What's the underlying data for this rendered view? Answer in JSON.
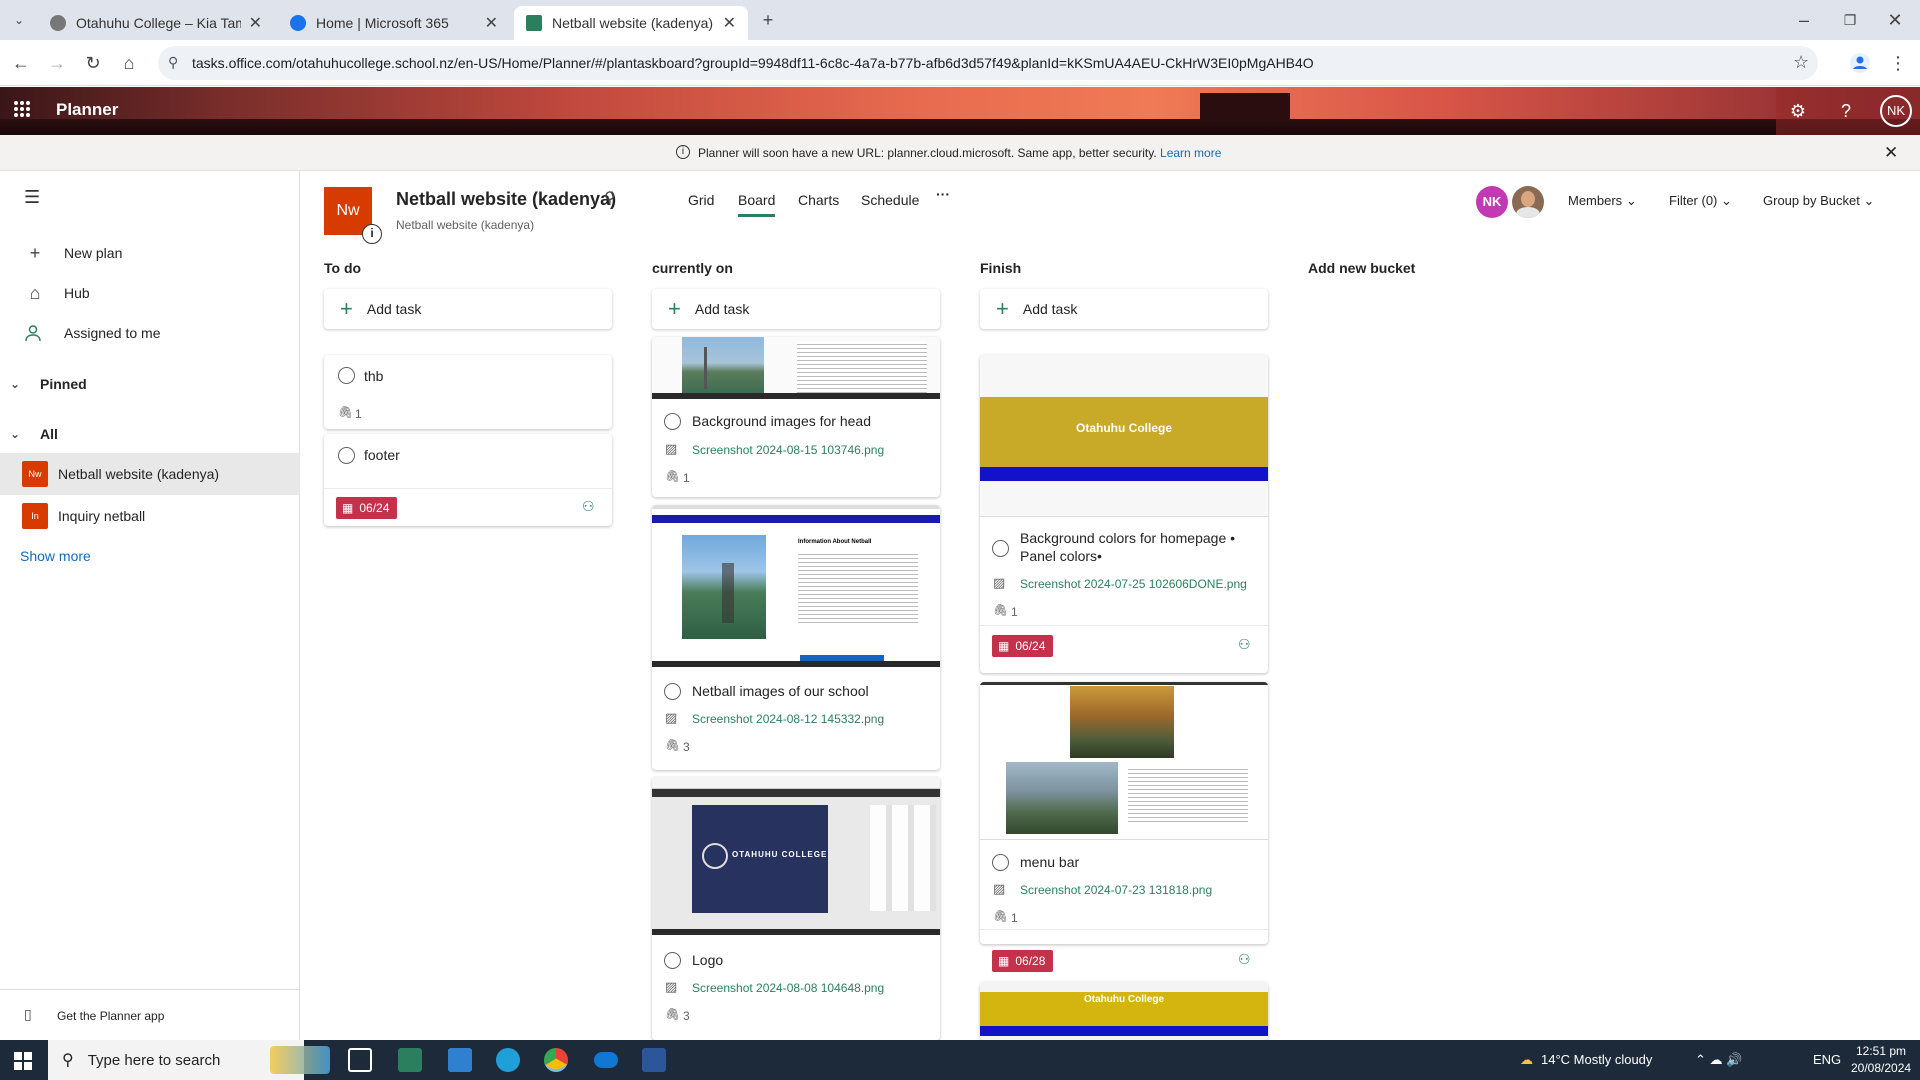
{
  "browser": {
    "tabs": [
      {
        "title": "Otahuhu College – Kia Tamatar",
        "color": "#555555"
      },
      {
        "title": "Home | Microsoft 365",
        "color": "#1a73e8"
      },
      {
        "title": "Netball website (kadenya) - Pla",
        "color": "#2b7f5f"
      }
    ],
    "url": "tasks.office.com/otahuhucollege.school.nz/en-US/Home/Planner/#/plantaskboard?groupId=9948df11-6c8c-4a7a-b77b-afb6d3d57f49&planId=kKSmUA4AEU-CkHrW3EI0pMgAHB4O"
  },
  "app": {
    "name": "Planner",
    "avatar": "NK",
    "notice": "Planner will soon have a new URL: planner.cloud.microsoft. Same app, better security.",
    "notice_link": "Learn more"
  },
  "nav": {
    "new_plan": "New plan",
    "hub": "Hub",
    "assigned": "Assigned to me",
    "pinned": "Pinned",
    "all": "All",
    "plans": [
      {
        "initials": "Nw",
        "name": "Netball website (kadenya)"
      },
      {
        "initials": "In",
        "name": "Inquiry netball"
      }
    ],
    "show_more": "Show more",
    "get_app": "Get the Planner app"
  },
  "plan": {
    "icon": "Nw",
    "title": "Netball website (kadenya)",
    "subtitle": "Netball website (kadenya)",
    "tabs": [
      "Grid",
      "Board",
      "Charts",
      "Schedule",
      "···"
    ],
    "members_avatar": "NK",
    "members": "Members",
    "filter": "Filter (0)",
    "group_by": "Group by Bucket"
  },
  "board": {
    "add_task": "Add task",
    "add_bucket": "Add new bucket",
    "buckets": [
      {
        "name": "To do"
      },
      {
        "name": "currently on"
      },
      {
        "name": "Finish"
      }
    ],
    "cards": {
      "thb": {
        "title": "thb",
        "attachments": "1"
      },
      "footer": {
        "title": "footer",
        "due": "06/24"
      },
      "bg_images": {
        "title": "Background images for head",
        "attachment": "Screenshot 2024-08-15 103746.png",
        "attachments": "1"
      },
      "netball_images": {
        "title": "Netball images of our school",
        "attachment": "Screenshot 2024-08-12 145332.png",
        "attachments": "3"
      },
      "logo": {
        "title": "Logo",
        "attachment": "Screenshot 2024-08-08 104648.png",
        "attachments": "3"
      },
      "bg_colors": {
        "title": "Background colors for homepage • Panel colors•",
        "attachment": "Screenshot 2024-07-25 102606DONE.png",
        "attachments": "1",
        "due": "06/24",
        "preview_title": "Otahuhu College"
      },
      "menu_bar": {
        "title": "menu bar",
        "attachment": "Screenshot 2024-07-23 131818.png",
        "attachments": "1",
        "due": "06/28"
      },
      "last": {
        "preview_title": "Otahuhu College"
      }
    },
    "preview_texts": {
      "info_heading": "Information About Netball",
      "logo_text": "OTAHUHU COLLEGE"
    }
  },
  "taskbar": {
    "search": "Type here to search",
    "weather": "14°C  Mostly cloudy",
    "lang": "ENG",
    "time": "12:51 pm",
    "date": "20/08/2024"
  }
}
